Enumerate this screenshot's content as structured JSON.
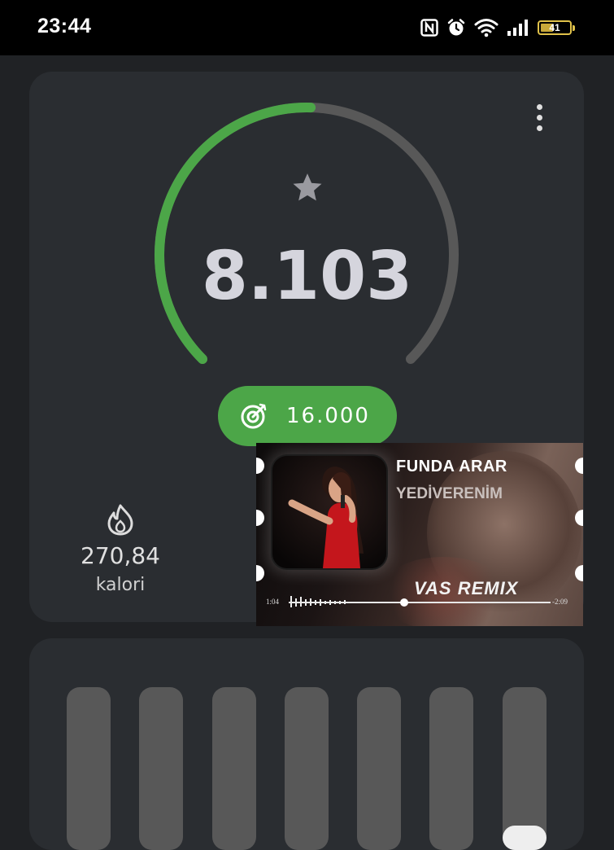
{
  "status_bar": {
    "time": "23:44",
    "battery": "41",
    "icons": [
      "nfc-icon",
      "alarm-icon",
      "wifi-icon",
      "signal-icon",
      "battery-icon"
    ]
  },
  "steps_card": {
    "steps": "8.103",
    "goal": "16.000",
    "progress": 0.506,
    "calories_value": "270,84",
    "calories_label": "kalori",
    "accent_color": "#4ca648",
    "track_color": "#585858"
  },
  "media_overlay": {
    "artist": "FUNDA ARAR",
    "song": "YEDİVERENİM",
    "tag": "VAS REMIX",
    "time_elapsed": "1:04",
    "time_remaining": "-2:09",
    "playback_progress": 0.44
  },
  "weekly_chart": {
    "bars": [
      0,
      0,
      0,
      0,
      0,
      0,
      0.15
    ]
  }
}
